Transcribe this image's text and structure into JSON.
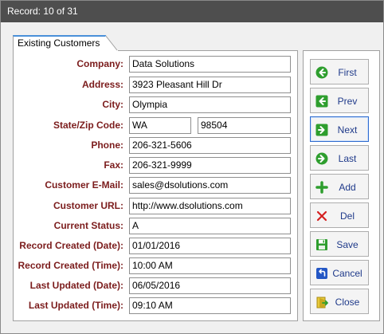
{
  "window": {
    "title": "Record: 10 of 31"
  },
  "tab": {
    "label": "Existing Customers"
  },
  "form": {
    "company_label": "Company:",
    "company": "Data Solutions",
    "address_label": "Address:",
    "address": "3923 Pleasant Hill Dr",
    "city_label": "City:",
    "city": "Olympia",
    "statezip_label": "State/Zip Code:",
    "state": "WA",
    "zip": "98504",
    "phone_label": "Phone:",
    "phone": "206-321-5606",
    "fax_label": "Fax:",
    "fax": "206-321-9999",
    "email_label": "Customer E-Mail:",
    "email": "sales@dsolutions.com",
    "url_label": "Customer URL:",
    "url": "http://www.dsolutions.com",
    "status_label": "Current Status:",
    "status": "A",
    "created_date_label": "Record Created (Date):",
    "created_date": "01/01/2016",
    "created_time_label": "Record Created (Time):",
    "created_time": "10:00 AM",
    "updated_date_label": "Last Updated (Date):",
    "updated_date": "06/05/2016",
    "updated_time_label": "Last Updated (Time):",
    "updated_time": "09:10 AM"
  },
  "buttons": {
    "first": "First",
    "prev": "Prev",
    "next": "Next",
    "last": "Last",
    "add": "Add",
    "del": "Del",
    "save": "Save",
    "cancel": "Cancel",
    "close": "Close"
  },
  "icons": {
    "first": "circle-arrow-left-icon",
    "prev": "square-arrow-left-icon",
    "next": "square-arrow-right-icon",
    "last": "circle-arrow-right-icon",
    "add": "plus-icon",
    "del": "x-icon",
    "save": "floppy-disk-icon",
    "cancel": "undo-icon",
    "close": "door-exit-icon"
  },
  "colors": {
    "titlebar": "#4e4e4e",
    "label": "#7b1c1c",
    "button_text": "#1f3a8a",
    "nav_green": "#2e9e2e",
    "delete_red": "#d42020",
    "tab_accent": "#4a90d9"
  }
}
